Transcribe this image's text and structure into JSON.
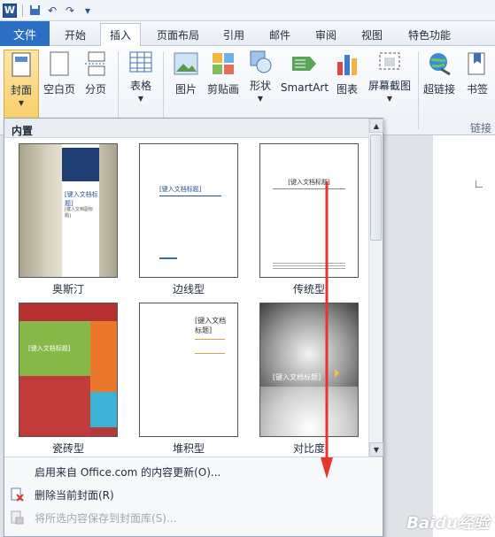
{
  "qat": {
    "word_icon": "W",
    "icons": [
      "save-icon",
      "undo-icon",
      "redo-icon",
      "customize-icon"
    ]
  },
  "tabs": [
    {
      "label": "文件"
    },
    {
      "label": "开始"
    },
    {
      "label": "插入"
    },
    {
      "label": "页面布局"
    },
    {
      "label": "引用"
    },
    {
      "label": "邮件"
    },
    {
      "label": "审阅"
    },
    {
      "label": "视图"
    },
    {
      "label": "特色功能"
    }
  ],
  "ribbon": {
    "buttons": [
      {
        "label": "封面"
      },
      {
        "label": "空白页"
      },
      {
        "label": "分页"
      },
      {
        "label": "表格"
      },
      {
        "label": "图片"
      },
      {
        "label": "剪贴画"
      },
      {
        "label": "形状"
      },
      {
        "label": "SmartArt"
      },
      {
        "label": "图表"
      },
      {
        "label": "屏幕截图"
      },
      {
        "label": "超链接"
      },
      {
        "label": "书签"
      }
    ],
    "group_link": "链接"
  },
  "pane": {
    "header": "内置",
    "covers": [
      {
        "caption": "奥斯汀",
        "title": "[键入文档标题]",
        "subtitle": "[键入文档副标题]"
      },
      {
        "caption": "边线型",
        "title": "[键入文档标题]"
      },
      {
        "caption": "传统型",
        "title": "[键入文档标题]"
      },
      {
        "caption": "瓷砖型",
        "title": "[键入文档标题]"
      },
      {
        "caption": "堆积型",
        "title": "[键入文档标题]"
      },
      {
        "caption": "对比度",
        "title": "[键入文档标题]"
      }
    ],
    "menu": [
      {
        "label": "启用来自 Office.com 的内容更新(O)...",
        "enabled": true
      },
      {
        "label": "删除当前封面(R)",
        "enabled": true
      },
      {
        "label": "将所选内容保存到封面库(S)...",
        "enabled": false
      }
    ]
  },
  "watermark": "Baidu经验",
  "colors": {
    "accent": "#2b6fc4",
    "annotation_arrow": "#e8332f",
    "selected": "#f9cf6b"
  }
}
